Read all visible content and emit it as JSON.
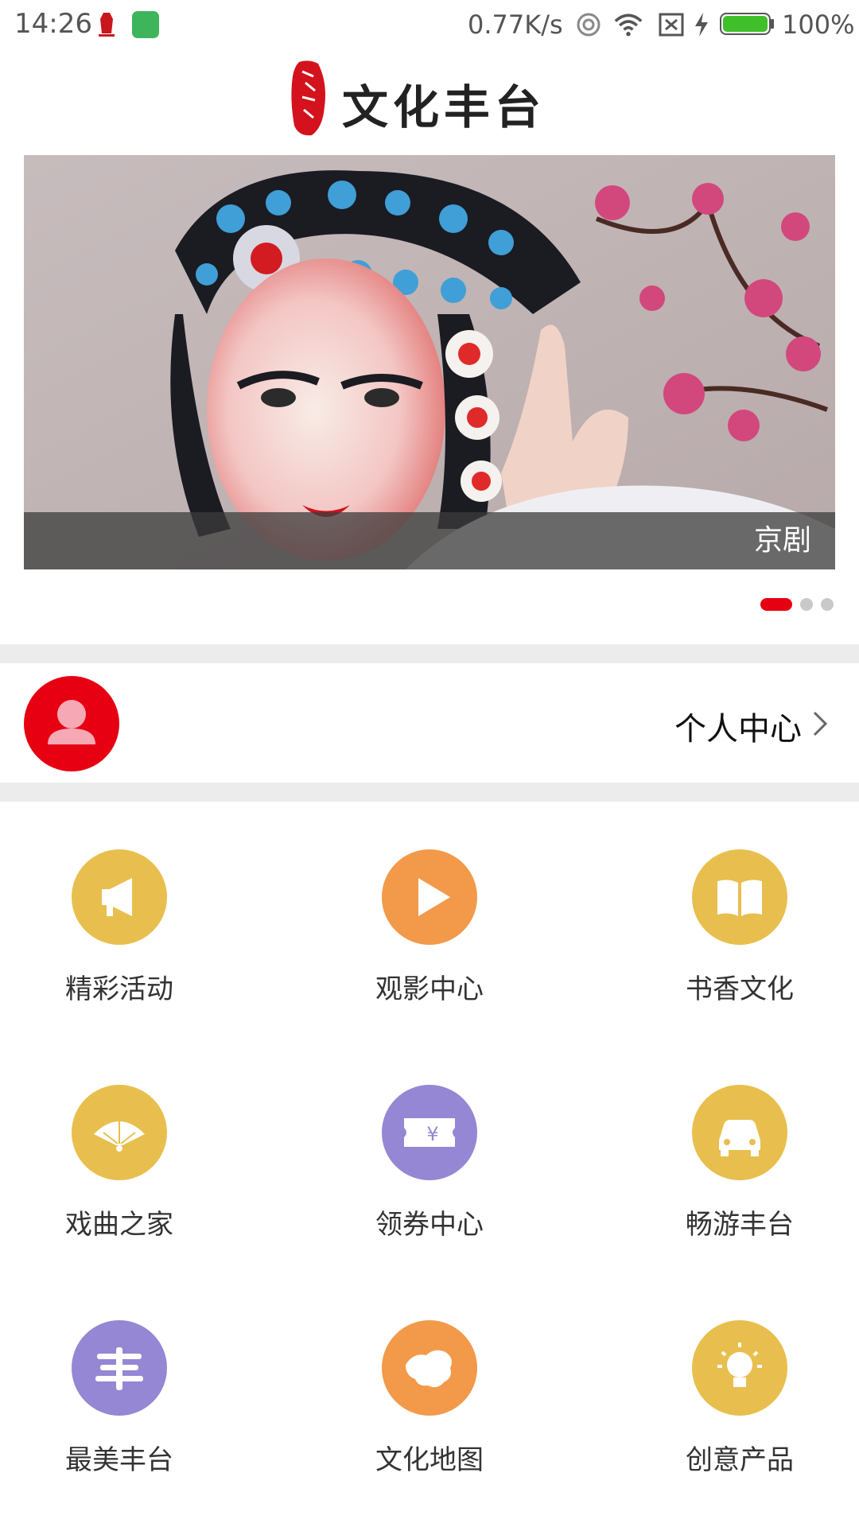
{
  "status_bar": {
    "time": "14:26",
    "net_speed": "0.77K/s",
    "battery_pct": "100%",
    "battery_level": 1.0,
    "icons": [
      "hotspot-icon",
      "wifi-icon",
      "no-sim-icon",
      "charging-icon",
      "battery-icon"
    ]
  },
  "header": {
    "logo_title": "文化丰台",
    "seal_icon": "seal-logo-icon"
  },
  "banner": {
    "caption": "京剧",
    "page_count": 3,
    "active_page": 1
  },
  "profile": {
    "label": "个人中心",
    "avatar_icon": "user-icon",
    "avatar_color": "#e60012"
  },
  "colors": {
    "accent_red": "#e50012",
    "yellow": "#e8bf4e",
    "orange": "#f29a4a",
    "purple": "#9587d3"
  },
  "grid": [
    {
      "label": "精彩活动",
      "icon": "megaphone-icon",
      "color": "#e8bf4e"
    },
    {
      "label": "观影中心",
      "icon": "play-icon",
      "color": "#f29a4a"
    },
    {
      "label": "书香文化",
      "icon": "book-icon",
      "color": "#e8bf4e"
    },
    {
      "label": "戏曲之家",
      "icon": "fan-icon",
      "color": "#e8bf4e"
    },
    {
      "label": "领券中心",
      "icon": "coupon-icon",
      "color": "#9587d3"
    },
    {
      "label": "畅游丰台",
      "icon": "car-icon",
      "color": "#e8bf4e"
    },
    {
      "label": "最美丰台",
      "icon": "feng-icon",
      "color": "#9587d3"
    },
    {
      "label": "文化地图",
      "icon": "china-map-icon",
      "color": "#f29a4a"
    },
    {
      "label": "创意产品",
      "icon": "lightbulb-icon",
      "color": "#e8bf4e"
    }
  ]
}
